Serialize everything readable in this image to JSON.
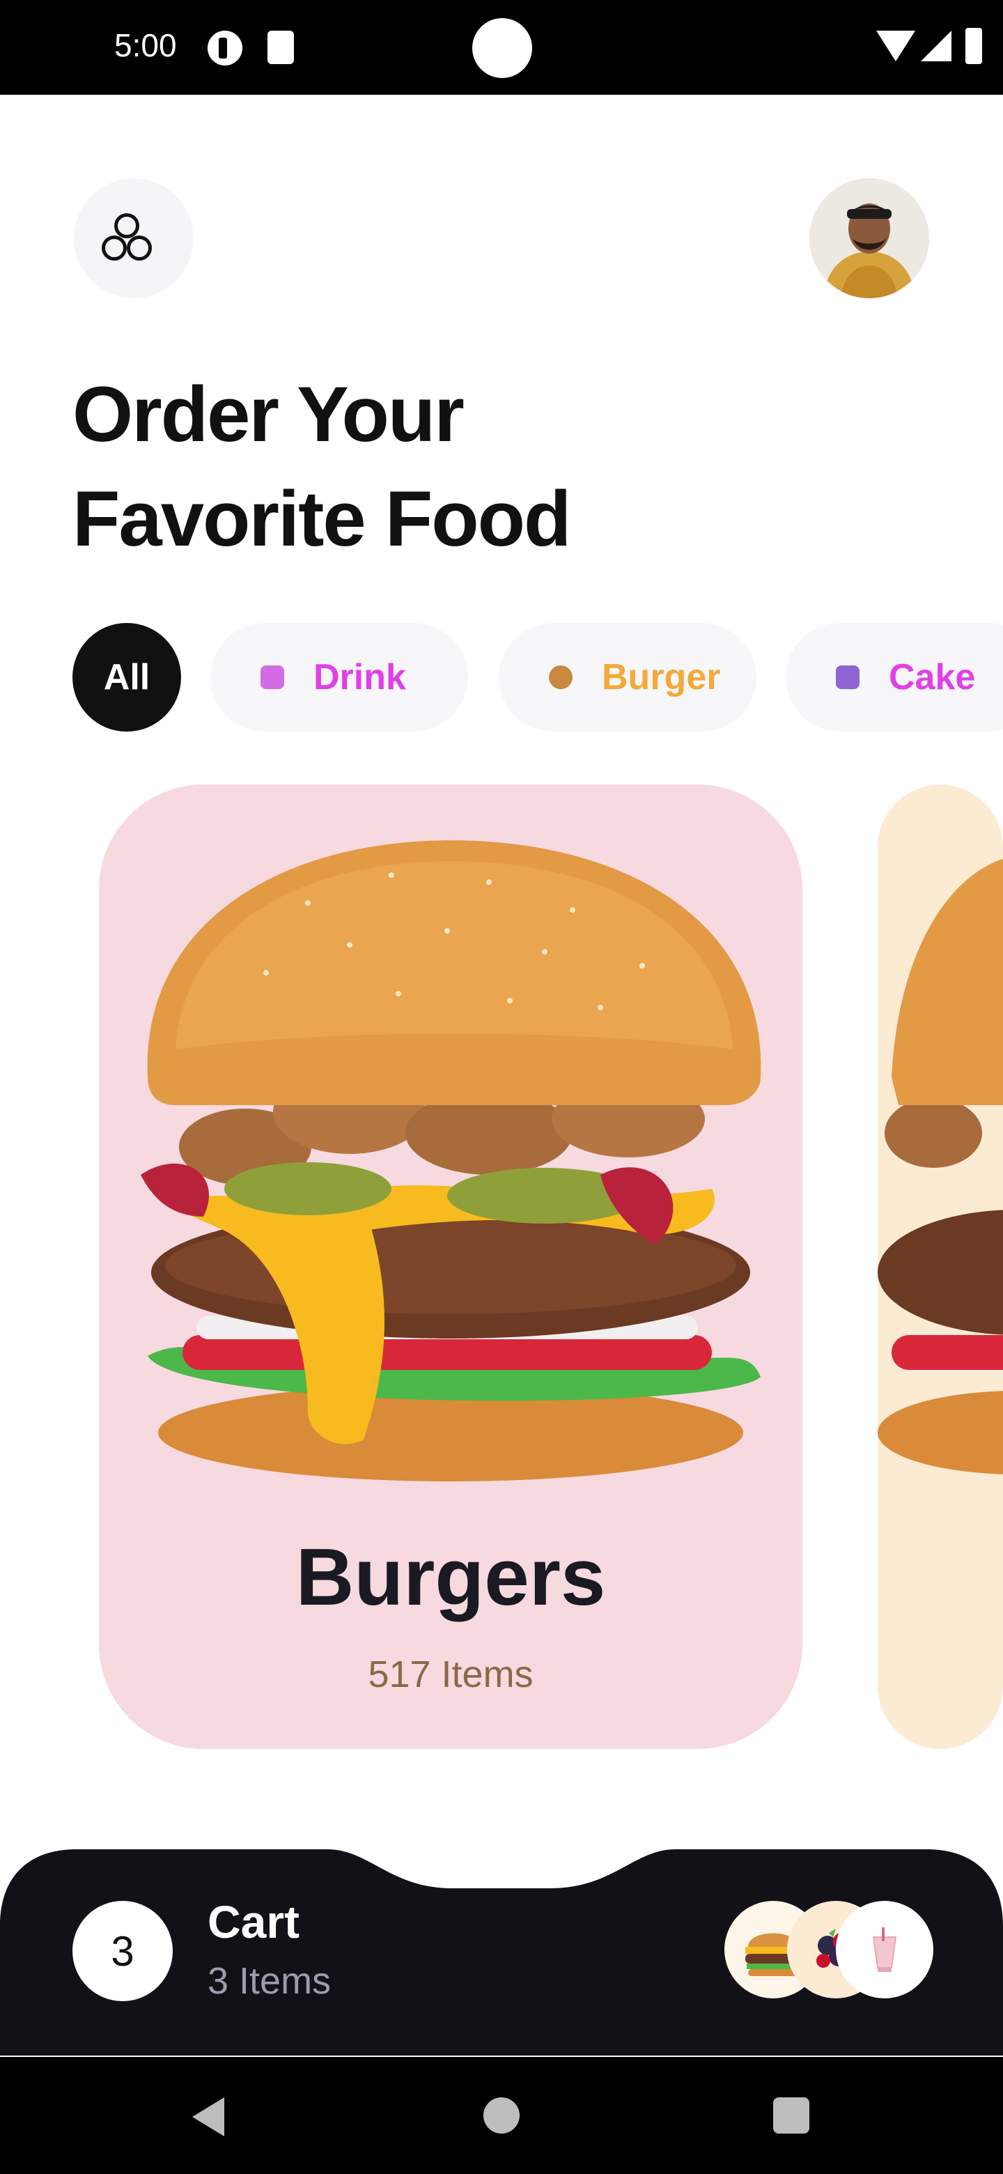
{
  "status_bar": {
    "time": "5:00"
  },
  "header": {
    "menu_icon": "three-circles-icon",
    "avatar_alt": "user-avatar"
  },
  "title_lines": [
    "Order Your",
    "Favorite Food"
  ],
  "categories": [
    {
      "label": "All",
      "selected": true
    },
    {
      "label": "Drink",
      "color": "#e040e8",
      "icon": "drink-cup-icon"
    },
    {
      "label": "Burger",
      "color": "#f4a93a",
      "icon": "burger-icon"
    },
    {
      "label": "Cake",
      "color": "#e040e8",
      "icon": "cake-icon"
    }
  ],
  "featured": {
    "title": "Burgers",
    "subtitle": "517 Items",
    "bg": "#f7d9e0"
  },
  "cart": {
    "count": "3",
    "title": "Cart",
    "subtitle": "3 Items"
  },
  "colors": {
    "dark": "#111117",
    "accent_pink": "#e040e8",
    "accent_orange": "#f4a93a"
  }
}
